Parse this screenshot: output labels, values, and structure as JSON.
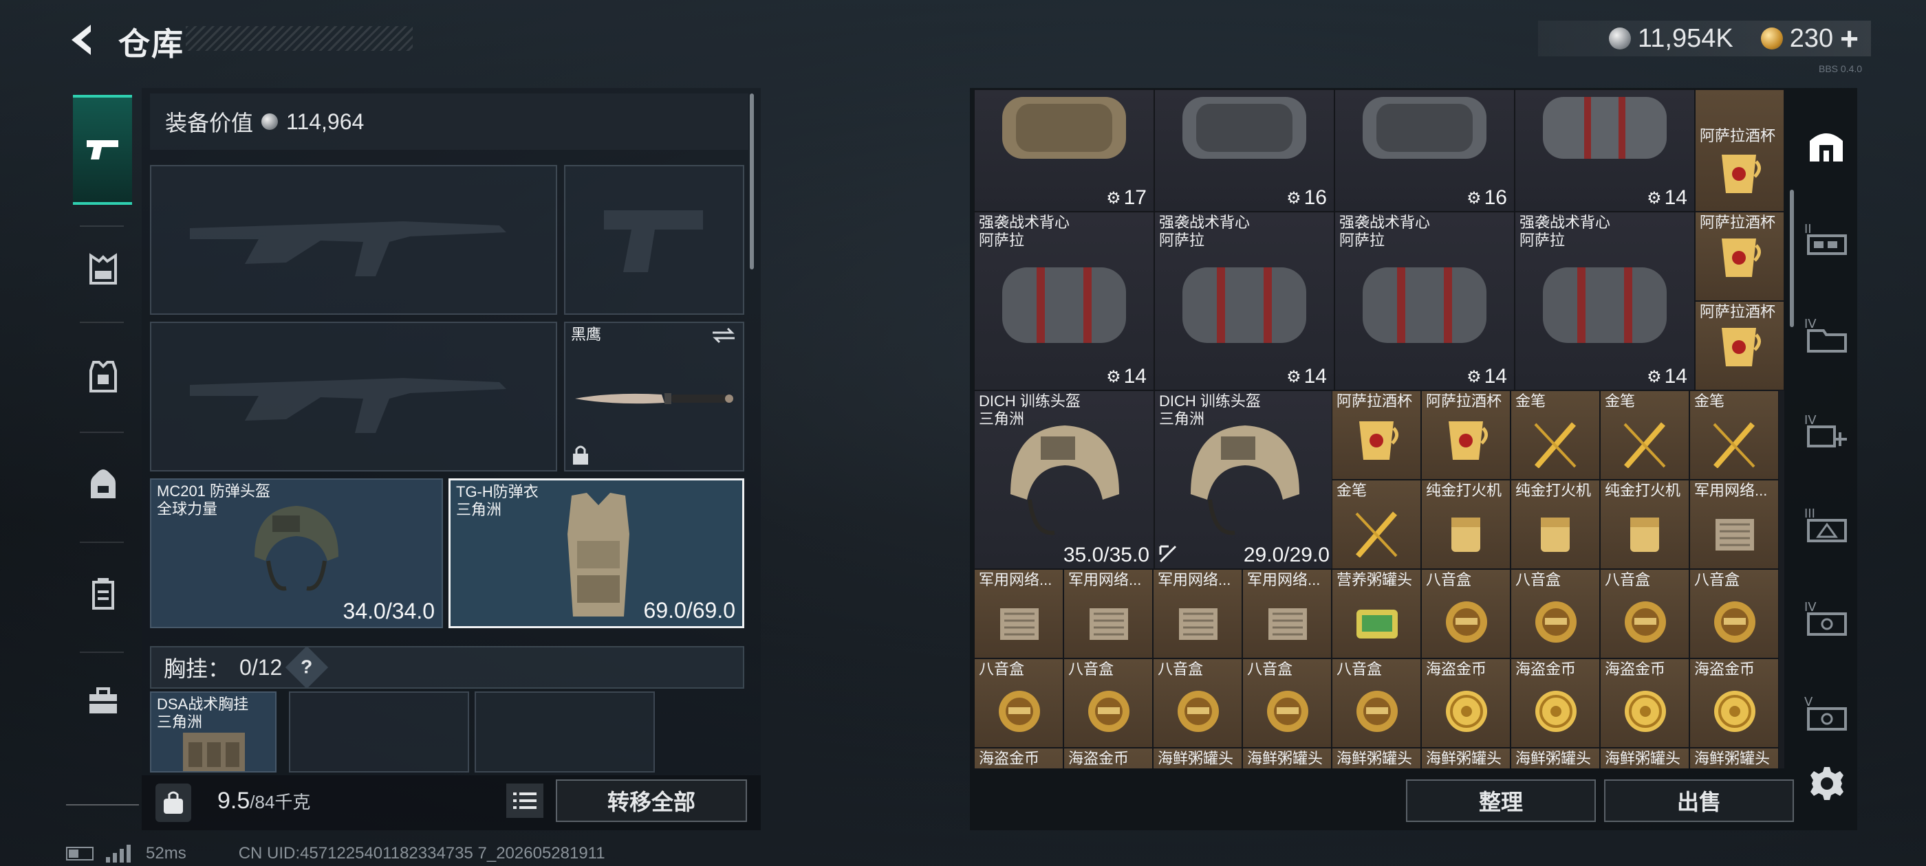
{
  "header": {
    "title": "仓库",
    "currency": [
      {
        "name": "silver-coin",
        "amount": "11,954K"
      },
      {
        "name": "gold-coin",
        "amount": "230"
      }
    ],
    "add_label": "+",
    "version": "BBS 0.4.0"
  },
  "left_rail": {
    "categories": [
      "weapons",
      "chest-rig",
      "armor",
      "backpack",
      "container",
      "toolbox"
    ],
    "active": "weapons"
  },
  "loadout": {
    "equip_value_label": "装备价值",
    "equip_value": "114,964",
    "melee": {
      "name": "黑鹰"
    },
    "helmet": {
      "name": "MC201 防弹头盔",
      "sub": "全球力量",
      "durability": "34.0/34.0"
    },
    "armor": {
      "name": "TG-H防弹衣",
      "sub": "三角洲",
      "durability": "69.0/69.0"
    },
    "vest_label": "胸挂",
    "vest_capacity": "0/12",
    "vest_help": "?",
    "chest_rig": {
      "name": "DSA战术胸挂",
      "sub": "三角洲"
    },
    "weight": "9.5",
    "weight_max": "/84千克",
    "transfer_all": "转移全部"
  },
  "status": {
    "ping": "52ms",
    "uid": "CN UID:4571225401182334735 7_202605281911"
  },
  "stash": {
    "row0": [
      {
        "count": "17"
      },
      {
        "count": "16"
      },
      {
        "count": "16"
      },
      {
        "count": "14"
      }
    ],
    "row0_tall": "阿萨拉酒杯",
    "row1": [
      {
        "name1": "强袭战术背心",
        "name2": "阿萨拉",
        "count": "14"
      },
      {
        "name1": "强袭战术背心",
        "name2": "阿萨拉",
        "count": "14"
      },
      {
        "name1": "强袭战术背心",
        "name2": "阿萨拉",
        "count": "14"
      },
      {
        "name1": "强袭战术背心",
        "name2": "阿萨拉",
        "count": "14"
      }
    ],
    "row1_side": [
      "阿萨拉酒杯",
      "阿萨拉酒杯"
    ],
    "helmets": [
      {
        "name1": "DICH 训练头盔",
        "name2": "三角洲",
        "durability": "35.0/35.0"
      },
      {
        "name1": "DICH 训练头盔",
        "name2": "三角洲",
        "durability": "29.0/29.0"
      }
    ],
    "small_row_a": [
      "阿萨拉酒杯",
      "阿萨拉酒杯",
      "金笔",
      "金笔",
      "金笔"
    ],
    "small_row_b": [
      "金笔",
      "纯金打火机",
      "纯金打火机",
      "纯金打火机",
      "军用网络..."
    ],
    "small_row_c": [
      "军用网络...",
      "军用网络...",
      "军用网络...",
      "军用网络...",
      "营养粥罐头",
      "八音盒",
      "八音盒",
      "八音盒",
      "八音盒"
    ],
    "small_row_d": [
      "八音盒",
      "八音盒",
      "八音盒",
      "八音盒",
      "八音盒",
      "海盗金币",
      "海盗金币",
      "海盗金币",
      "海盗金币"
    ],
    "small_row_e": [
      "海盗金币",
      "海盗金币",
      "海鲜粥罐头",
      "海鲜粥罐头",
      "海鲜粥罐头",
      "海鲜粥罐头",
      "海鲜粥罐头",
      "海鲜粥罐头",
      "海鲜粥罐头"
    ],
    "sort": "整理",
    "sell": "出售"
  },
  "right_rail": {
    "items": [
      "stash-home",
      "safe-box-II",
      "storage-IV",
      "expand-IV",
      "container-III",
      "container-IV",
      "container-V"
    ],
    "labels": [
      "",
      "II",
      "IV",
      "IV",
      "III",
      "IV",
      "V"
    ]
  },
  "colors": {
    "accent": "#2fd0b0",
    "slot_blue": "#2b3f52",
    "gold_cell": "#5c4a36",
    "purple_cell": "#2c2d36"
  }
}
